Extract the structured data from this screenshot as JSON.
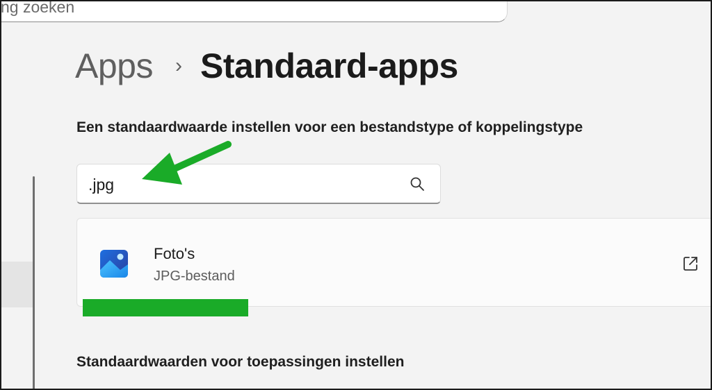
{
  "top_search": {
    "text": "ng zoeken"
  },
  "breadcrumb": {
    "parent": "Apps",
    "separator": "›",
    "current": "Standaard-apps"
  },
  "filetype_section": {
    "label": "Een standaardwaarde instellen voor een bestandstype of koppelingstype",
    "search_value": ".jpg"
  },
  "result": {
    "app_name": "Foto's",
    "file_type": "JPG-bestand"
  },
  "apps_section": {
    "label": "Standaardwaarden voor toepassingen instellen"
  },
  "icons": {
    "search": "search-icon",
    "app": "photos-app-icon",
    "open": "open-external-icon"
  },
  "colors": {
    "annotation_green": "#1aab28",
    "background": "#f3f3f3"
  }
}
